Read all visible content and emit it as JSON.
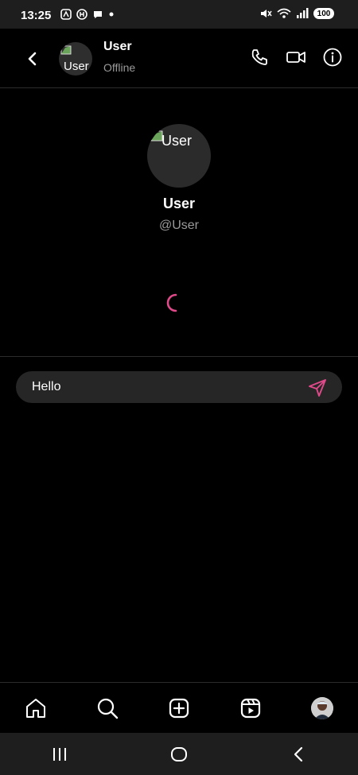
{
  "status_bar": {
    "time": "13:25",
    "battery": "100",
    "icons": [
      "notification-a-icon",
      "notification-h-icon",
      "chat-bubble-icon",
      "dot-icon",
      "mute-icon",
      "wifi-icon",
      "signal-icon",
      "battery-icon"
    ]
  },
  "header": {
    "name": "User",
    "status": "Offline",
    "avatar_alt": "User",
    "actions": [
      "phone-icon",
      "video-icon",
      "info-icon"
    ]
  },
  "profile": {
    "avatar_alt": "User",
    "name": "User",
    "handle": "@User"
  },
  "composer": {
    "value": "Hello",
    "send_icon": "send-icon"
  },
  "bottom_nav": {
    "items": [
      "home-icon",
      "search-icon",
      "create-icon",
      "reels-icon",
      "profile-avatar"
    ]
  },
  "system_nav": {
    "items": [
      "recents-icon",
      "home-circle-icon",
      "back-icon"
    ]
  },
  "colors": {
    "background": "#000000",
    "surface": "#262626",
    "muted_text": "#9a9a9a",
    "accent": "#e04a8a"
  }
}
